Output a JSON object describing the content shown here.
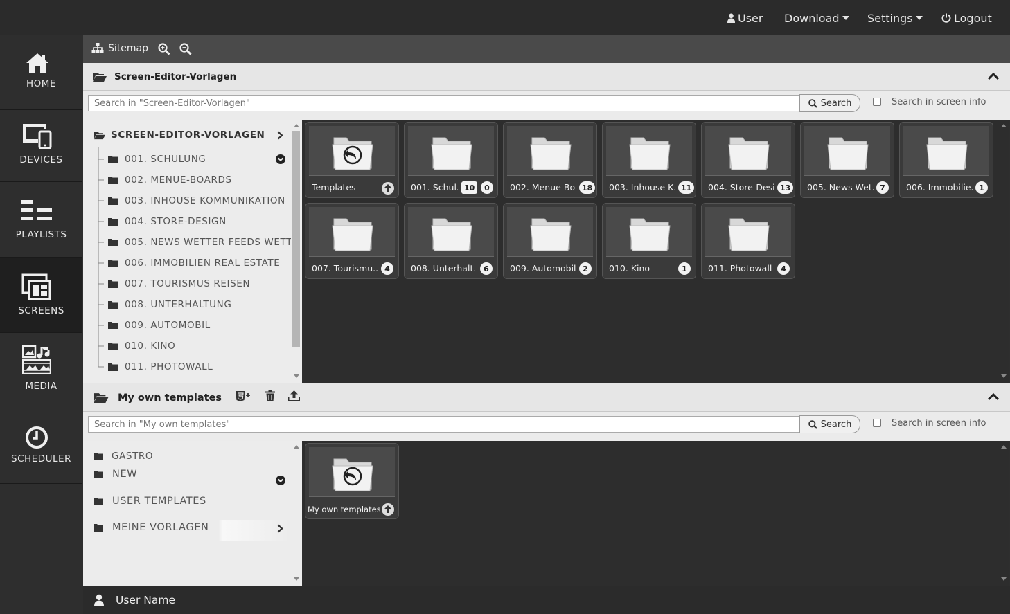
{
  "topbar": {
    "user": "User",
    "download": "Download",
    "settings": "Settings",
    "logout": "Logout"
  },
  "sidenav": {
    "home": "HOME",
    "devices": "DEVICES",
    "playlists": "PLAYLISTS",
    "screens": "SCREENS",
    "media": "MEDIA",
    "scheduler": "SCHEDULER",
    "active": "SCREENS"
  },
  "toolbar": {
    "sitemap": "Sitemap"
  },
  "panel1": {
    "title": "Screen-Editor-Vorlagen",
    "search_placeholder": "Search in \"Screen-Editor-Vorlagen\"",
    "search_button": "Search",
    "search_info_label": "Search in screen info",
    "tree_root": "SCREEN-EDITOR-VORLAGEN",
    "tree_items": [
      "001. SCHULUNG",
      "002. MENUE-BOARDS",
      "003. INHOUSE KOMMUNIKATION",
      "004. STORE-DESIGN",
      "005. NEWS WETTER FEEDS WETT",
      "006. IMMOBILIEN REAL ESTATE",
      "007. TOURISMUS REISEN",
      "008. UNTERHALTUNG",
      "009. AUTOMOBIL",
      "010. KINO",
      "011. PHOTOWALL"
    ],
    "tiles": [
      {
        "name": "Templates",
        "badge": "",
        "badge2": "",
        "back": true
      },
      {
        "name": "001. Schul...",
        "badge": "0",
        "badge2": "10"
      },
      {
        "name": "002. Menue-Bo...",
        "badge": "18",
        "badge2": ""
      },
      {
        "name": "003. Inhouse K...",
        "badge": "11",
        "badge2": ""
      },
      {
        "name": "004. Store-Desi...",
        "badge": "13",
        "badge2": ""
      },
      {
        "name": "005. News Wet...",
        "badge": "7",
        "badge2": ""
      },
      {
        "name": "006. Immobilie...",
        "badge": "1",
        "badge2": ""
      },
      {
        "name": "007. Tourismu...",
        "badge": "4",
        "badge2": ""
      },
      {
        "name": "008. Unterhalt...",
        "badge": "6",
        "badge2": ""
      },
      {
        "name": "009. Automobil",
        "badge": "2",
        "badge2": ""
      },
      {
        "name": "010. Kino",
        "badge": "1",
        "badge2": ""
      },
      {
        "name": "011. Photowall",
        "badge": "4",
        "badge2": ""
      }
    ]
  },
  "panel2": {
    "title": "My own templates",
    "search_placeholder": "Search in \"My own templates\"",
    "search_button": "Search",
    "search_info_label": "Search in screen info",
    "tree_items": [
      "GASTRO",
      "NEW",
      "USER TEMPLATES",
      "MEINE VORLAGEN"
    ],
    "tile": {
      "name": "My own templates"
    }
  },
  "footer": {
    "username": "User Name"
  }
}
